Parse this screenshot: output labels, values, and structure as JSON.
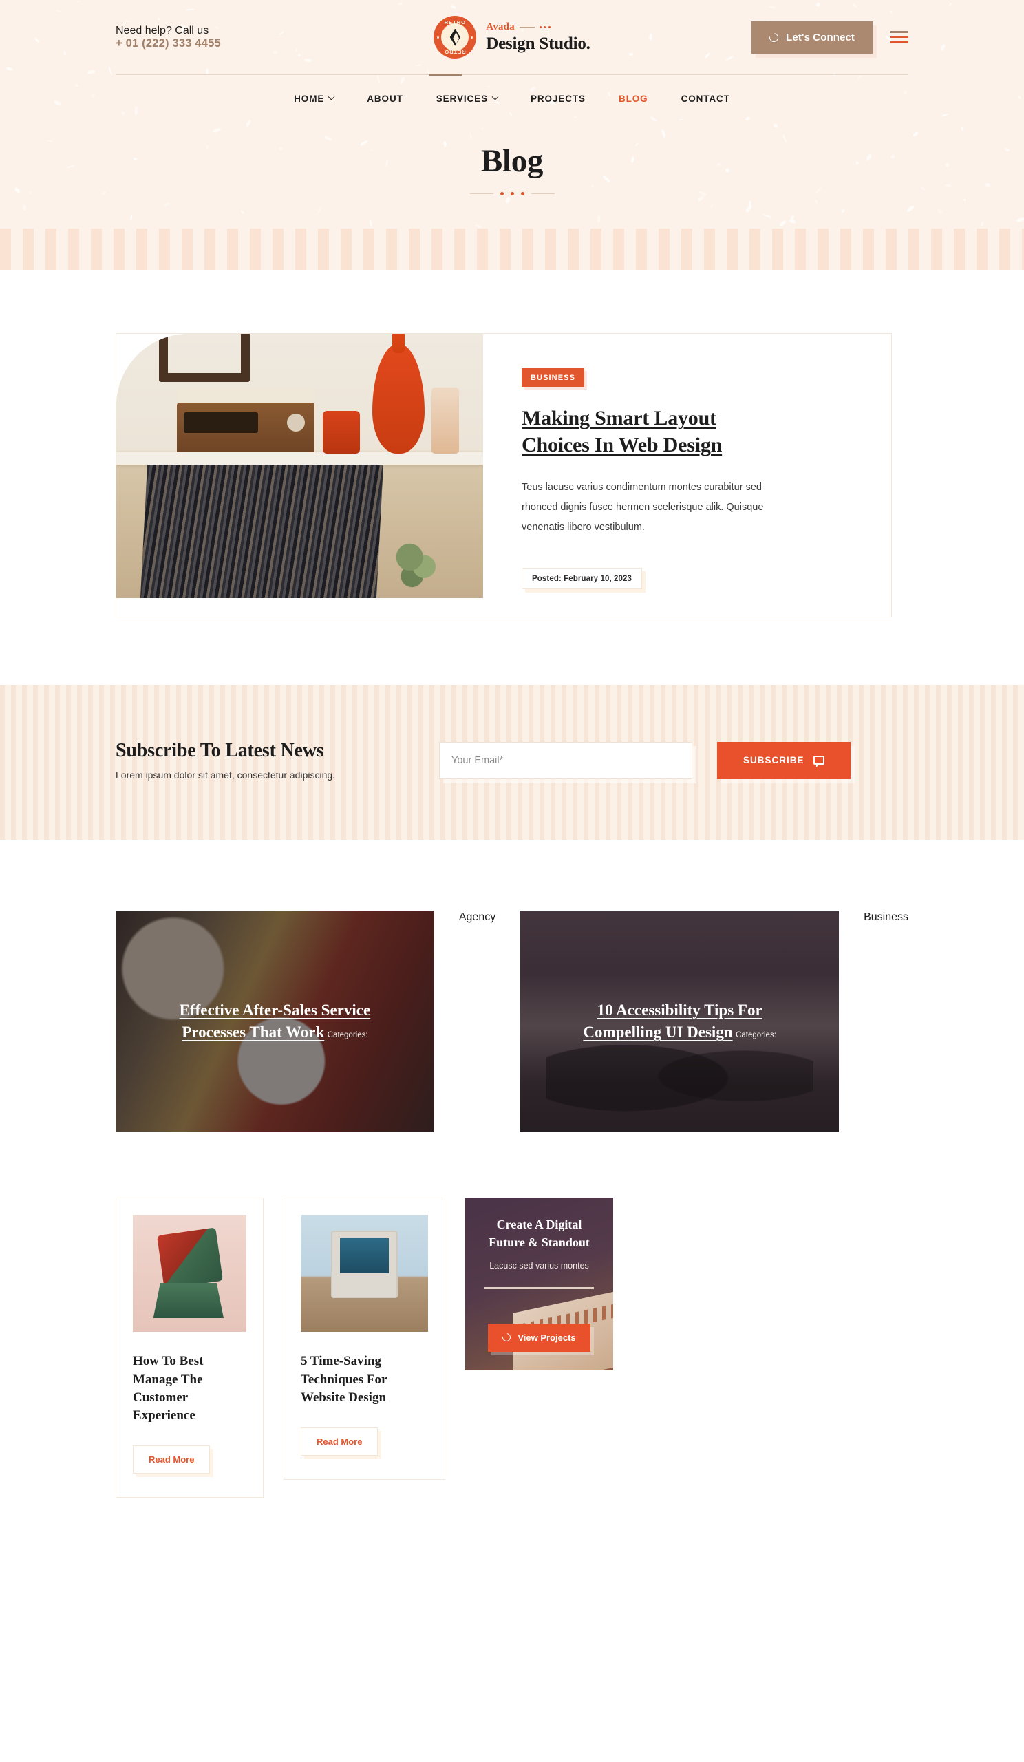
{
  "header": {
    "contact_label": "Need help? Call us",
    "phone": "+ 01 (222) 333 4455",
    "brand_badge_top": "RETRO",
    "brand_badge_bottom": "RETRO",
    "brand_eyebrow": "Avada",
    "brand_name": "Design Studio.",
    "connect_button": "Let's Connect",
    "icons": {
      "connect": "circle-loader-icon",
      "menu": "hamburger-menu-icon"
    }
  },
  "nav": {
    "items": [
      {
        "label": "HOME",
        "has_caret": true,
        "active": false
      },
      {
        "label": "ABOUT",
        "has_caret": false,
        "active": false
      },
      {
        "label": "SERVICES",
        "has_caret": true,
        "active": false
      },
      {
        "label": "PROJECTS",
        "has_caret": false,
        "active": false
      },
      {
        "label": "BLOG",
        "has_caret": false,
        "active": true
      },
      {
        "label": "CONTACT",
        "has_caret": false,
        "active": false
      }
    ]
  },
  "page": {
    "title": "Blog"
  },
  "featured_post": {
    "category": "BUSINESS",
    "title": "Making Smart Layout Choices In Web Design",
    "excerpt": "Teus lacusc varius condimentum montes curabitur sed rhonced dignis fusce hermen scelerisque alik. Quisque venenatis libero vestibulum.",
    "posted": "Posted: February 10, 2023",
    "image_alt": "record-player-vinyl-shelf-photo"
  },
  "subscribe": {
    "title": "Subscribe To Latest News",
    "subtitle": "Lorem ipsum dolor sit amet, consectetur adipiscing.",
    "email_placeholder": "Your Email*",
    "email_value": "",
    "button_label": "SUBSCRIBE",
    "button_icon": "speech-bubble-icon"
  },
  "tiles": [
    {
      "title": "Effective After-Sales Service Processes That Work",
      "cats_label": "Categories:",
      "cat": "Agency",
      "image_alt": "bottled-drinks-photo"
    },
    {
      "title": "10 Accessibility Tips For Compelling UI Design",
      "cats_label": "Categories:",
      "cat": "Business",
      "image_alt": "classic-car-photo"
    }
  ],
  "post_cards": [
    {
      "title": "How To Best Manage The Customer Experience",
      "button": "Read More",
      "image_alt": "red-green-chair-sculpture-photo"
    },
    {
      "title": "5 Time-Saving Techniques For Website Design",
      "button": "Read More",
      "image_alt": "vintage-macintosh-computer-photo"
    }
  ],
  "cta": {
    "title_line1": "Create A Digital",
    "title_line2": "Future & Standout",
    "subtitle": "Lacusc sed varius montes",
    "button_label": "View Projects",
    "button_icon": "circle-loader-icon"
  },
  "colors": {
    "accent_orange": "#e2562e",
    "accent_orange_bright": "#e8512b",
    "brand_tan": "#ab8870",
    "phone_tan": "#a2816a",
    "cream": "#fdf2e9",
    "stripe": "#fae3d3",
    "ink": "#1d1d1d"
  }
}
